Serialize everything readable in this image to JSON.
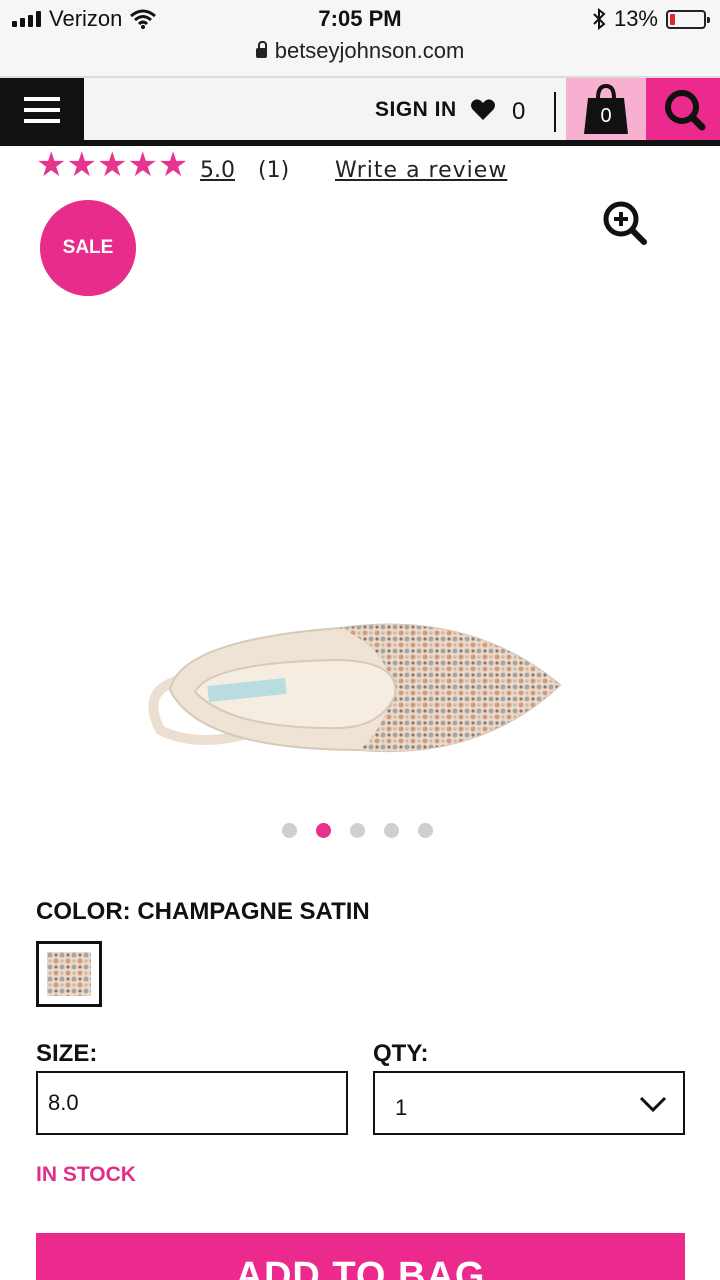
{
  "status_bar": {
    "carrier": "Verizon",
    "time": "7:05 PM",
    "battery": "13%",
    "battery_level": 0.13,
    "url": "betseyjohnson.com"
  },
  "header": {
    "sign_in": "SIGN IN",
    "wishlist_count": "0",
    "bag_count": "0",
    "colors": {
      "bag_bg": "#f7b0cf",
      "search_bg": "#ec2a8e",
      "menu_bg": "#111111"
    }
  },
  "reviews": {
    "stars": "★★★★★",
    "rating": "5.0",
    "count": "(1)",
    "write_review": "Write a review"
  },
  "product": {
    "sale_badge": "SALE",
    "color_label": "COLOR: CHAMPAGNE SATIN",
    "size_label": "SIZE:",
    "size_value": "8.0",
    "qty_label": "QTY:",
    "qty_value": "1",
    "stock_status": "IN STOCK",
    "add_to_bag": "ADD TO BAG",
    "carousel": {
      "total": 5,
      "active_index": 2
    },
    "accent_color": "#e8318f"
  }
}
